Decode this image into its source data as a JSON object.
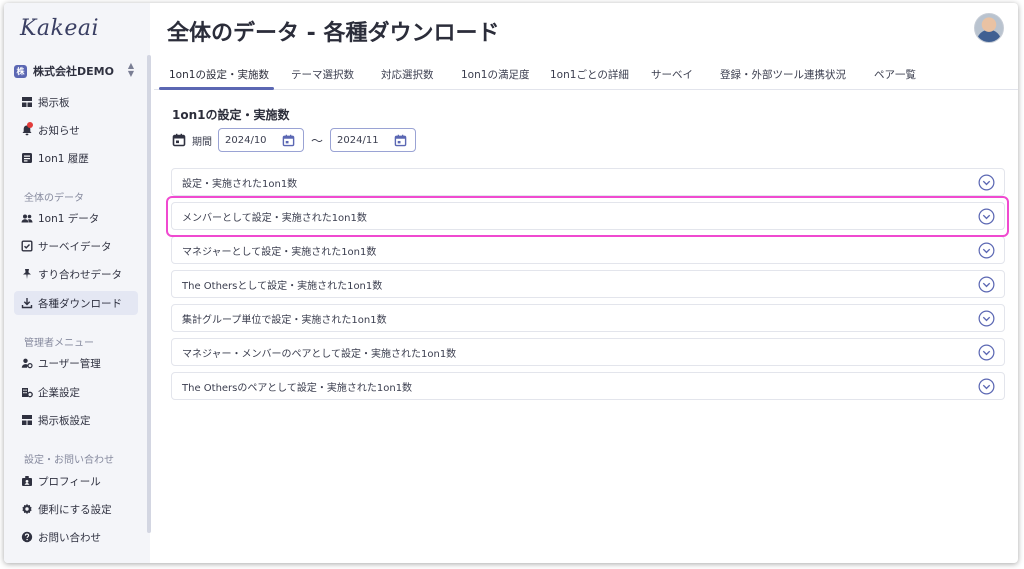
{
  "app": {
    "logo": "Kakeai",
    "company": {
      "badge": "株",
      "name": "株式会社DEMO"
    }
  },
  "sidebar": {
    "items_top": [
      {
        "label": "掲示板",
        "icon": "board-icon"
      },
      {
        "label": "お知らせ",
        "icon": "bell-icon"
      },
      {
        "label": "1on1 履歴",
        "icon": "history-icon"
      }
    ],
    "section_all_data": "全体のデータ",
    "items_data": [
      {
        "label": "1on1 データ",
        "icon": "people-icon"
      },
      {
        "label": "サーベイデータ",
        "icon": "survey-icon"
      },
      {
        "label": "すり合わせデータ",
        "icon": "pin-icon"
      },
      {
        "label": "各種ダウンロード",
        "icon": "download-icon"
      }
    ],
    "section_admin": "管理者メニュー",
    "items_admin": [
      {
        "label": "ユーザー管理",
        "icon": "user-manage-icon"
      },
      {
        "label": "企業設定",
        "icon": "company-settings-icon"
      },
      {
        "label": "掲示板設定",
        "icon": "board-settings-icon"
      }
    ],
    "section_settings": "設定・お問い合わせ",
    "items_settings": [
      {
        "label": "プロフィール",
        "icon": "profile-icon"
      },
      {
        "label": "便利にする設定",
        "icon": "gear-icon"
      },
      {
        "label": "お問い合わせ",
        "icon": "help-icon"
      }
    ]
  },
  "header": {
    "title": "全体のデータ - 各種ダウンロード"
  },
  "tabs": [
    {
      "label": "1on1の設定・実施数",
      "active": true
    },
    {
      "label": "テーマ選択数"
    },
    {
      "label": "対応選択数"
    },
    {
      "label": "1on1の満足度"
    },
    {
      "label": "1on1ごとの詳細"
    },
    {
      "label": "サーベイ"
    },
    {
      "label": "登録・外部ツール連携状況"
    },
    {
      "label": "ペア一覧"
    }
  ],
  "main": {
    "section_title": "1on1の設定・実施数",
    "period": {
      "label": "期間",
      "from": "2024/10",
      "tilde": "〜",
      "to": "2024/11"
    },
    "rows": [
      "設定・実施された1on1数",
      "メンバーとして設定・実施された1on1数",
      "マネジャーとして設定・実施された1on1数",
      "The Othersとして設定・実施された1on1数",
      "集計グループ単位で設定・実施された1on1数",
      "マネジャー・メンバーのペアとして設定・実施された1on1数",
      "The Othersのペアとして設定・実施された1on1数"
    ],
    "highlighted_row_index": 1
  },
  "colors": {
    "accent": "#5b67b3",
    "highlight": "#f04ad0",
    "sidebar_bg": "#f4f5f9",
    "notification": "#e23b3b"
  }
}
